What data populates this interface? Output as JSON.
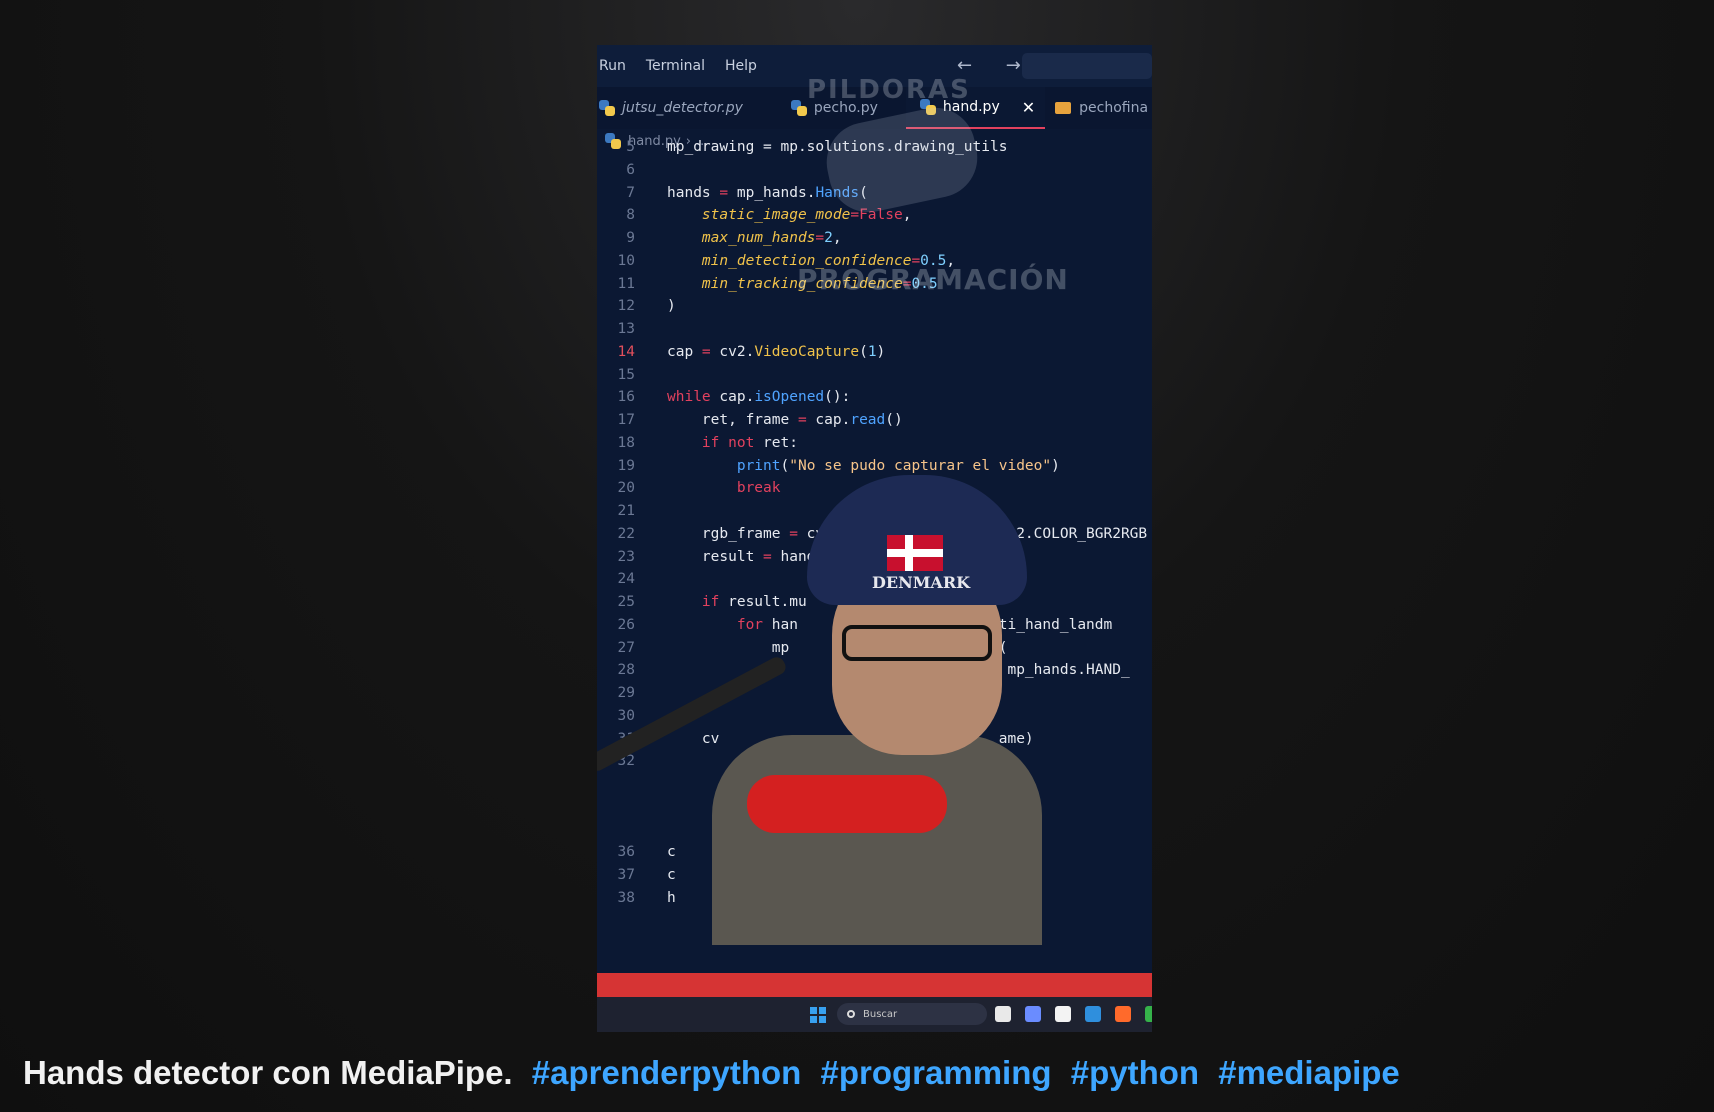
{
  "editor": {
    "menu": [
      "Run",
      "Terminal",
      "Help"
    ],
    "nav_arrows": "← →",
    "tabs": [
      {
        "label": "jutsu_detector.py",
        "icon": "python-icon",
        "italic": true,
        "active": false
      },
      {
        "label": "pecho.py",
        "icon": "python-icon",
        "italic": false,
        "active": false
      },
      {
        "label": "hand.py",
        "icon": "python-icon",
        "italic": false,
        "active": true
      },
      {
        "label": "pechofina",
        "icon": "cake-icon",
        "italic": false,
        "active": false
      }
    ],
    "close_glyph": "✕",
    "breadcrumb": {
      "file": "hand.py",
      "sep": "›",
      "rest": "..."
    },
    "watermark": {
      "top": "PILDORAS",
      "bottom": "PROGRAMACIÓN"
    },
    "current_line": "14",
    "lines": [
      {
        "n": "5",
        "html": "mp_drawing = mp.solutions.drawing_utils"
      },
      {
        "n": "6",
        "html": ""
      },
      {
        "n": "7",
        "html": "hands <span class='op'>=</span> mp_hands.<span class='fn'>Hands</span>("
      },
      {
        "n": "8",
        "html": "    <span class='param'>static_image_mode</span><span class='op'>=</span><span class='kw'>False</span>,"
      },
      {
        "n": "9",
        "html": "    <span class='param'>max_num_hands</span><span class='op'>=</span><span class='num'>2</span>,"
      },
      {
        "n": "10",
        "html": "    <span class='param'>min_detection_confidence</span><span class='op'>=</span><span class='num'>0.5</span>,"
      },
      {
        "n": "11",
        "html": "    <span class='param'>min_tracking_confidence</span><span class='op'>=</span><span class='num'>0.5</span>"
      },
      {
        "n": "12",
        "html": ")"
      },
      {
        "n": "13",
        "html": ""
      },
      {
        "n": "14",
        "html": "cap <span class='op'>=</span> cv2.<span class='param' style='font-style:normal'>VideoCapture</span>(<span class='num'>1</span>)"
      },
      {
        "n": "15",
        "html": ""
      },
      {
        "n": "16",
        "html": "<span class='kw'>while</span> cap.<span class='fn'>isOpened</span>():"
      },
      {
        "n": "17",
        "html": "    ret, frame <span class='op'>=</span> cap.<span class='fn'>read</span>()"
      },
      {
        "n": "18",
        "html": "    <span class='kw'>if not</span> ret:"
      },
      {
        "n": "19",
        "html": "        <span class='fn'>print</span>(<span class='str'>\"No se pudo capturar el video\"</span>)"
      },
      {
        "n": "20",
        "html": "        <span class='kw'>break</span>"
      },
      {
        "n": "21",
        "html": ""
      },
      {
        "n": "22",
        "html": "    rgb_frame <span class='op'>=</span> cv2                   cv2.COLOR_BGR2RGB"
      },
      {
        "n": "23",
        "html": "    result <span class='op'>=</span> hands                     )"
      },
      {
        "n": "24",
        "html": ""
      },
      {
        "n": "25",
        "html": "    <span class='kw'>if</span> result.mu"
      },
      {
        "n": "26",
        "html": "        <span class='kw'>for</span> han                      lti_hand_landm"
      },
      {
        "n": "27",
        "html": "            mp                       s("
      },
      {
        "n": "28",
        "html": "                                   ks, mp_hands.HAND_"
      },
      {
        "n": "29",
        "html": ""
      },
      {
        "n": "30",
        "html": ""
      },
      {
        "n": "31",
        "html": "    cv                                ame)"
      },
      {
        "n": "32",
        "html": ""
      },
      {
        "n": "36",
        "html": "c"
      },
      {
        "n": "37",
        "html": "c"
      },
      {
        "n": "38",
        "html": "h"
      }
    ]
  },
  "webcam": {
    "beanie_text": "DENMARK"
  },
  "taskbar": {
    "search_placeholder": "Buscar"
  },
  "caption": {
    "title": "Hands detector con MediaPipe.",
    "hashtags": [
      "#aprenderpython",
      "#programming",
      "#python",
      "#mediapipe"
    ]
  },
  "colors": {
    "accent_red": "#d63434",
    "hashtag_blue": "#3ea6ff",
    "editor_bg": "#0b1833"
  }
}
